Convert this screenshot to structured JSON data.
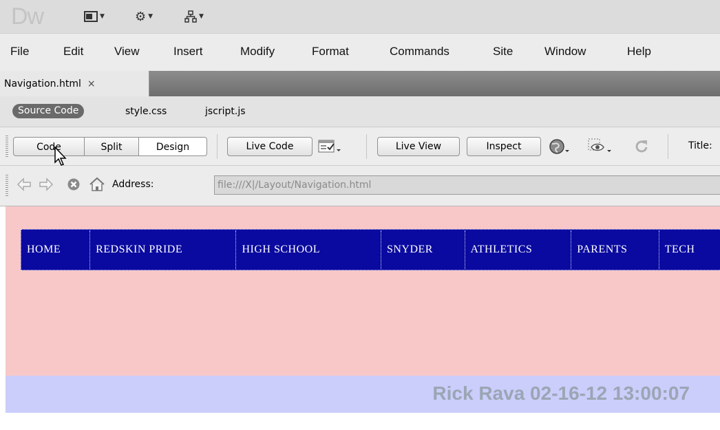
{
  "app": {
    "logo": "Dw"
  },
  "menu": [
    "File",
    "Edit",
    "View",
    "Insert",
    "Modify",
    "Format",
    "Commands",
    "Site",
    "Window",
    "Help"
  ],
  "document_tab": {
    "name": "Navigation.html",
    "close_glyph": "×"
  },
  "related_files": {
    "source": "Source Code",
    "files": [
      "style.css",
      "jscript.js"
    ]
  },
  "view_buttons": {
    "code": "Code",
    "split": "Split",
    "design": "Design",
    "live_code": "Live Code",
    "live_view": "Live View",
    "inspect": "Inspect",
    "title_label": "Title:"
  },
  "address": {
    "label": "Address:",
    "value": "file:///X|/Layout/Navigation.html"
  },
  "page": {
    "nav_items": [
      "HOME",
      "REDSKIN PRIDE",
      "HIGH SCHOOL",
      "SNYDER",
      "ATHLETICS",
      "PARENTS",
      "TECH"
    ],
    "footer": "Rick Rava 02-16-12 13:00:07"
  },
  "colors": {
    "pink": "#f8c8c8",
    "nav_blue": "#0a0aa0",
    "footer_blue": "#cbcdfb",
    "footer_text": "#9aa6b4"
  }
}
